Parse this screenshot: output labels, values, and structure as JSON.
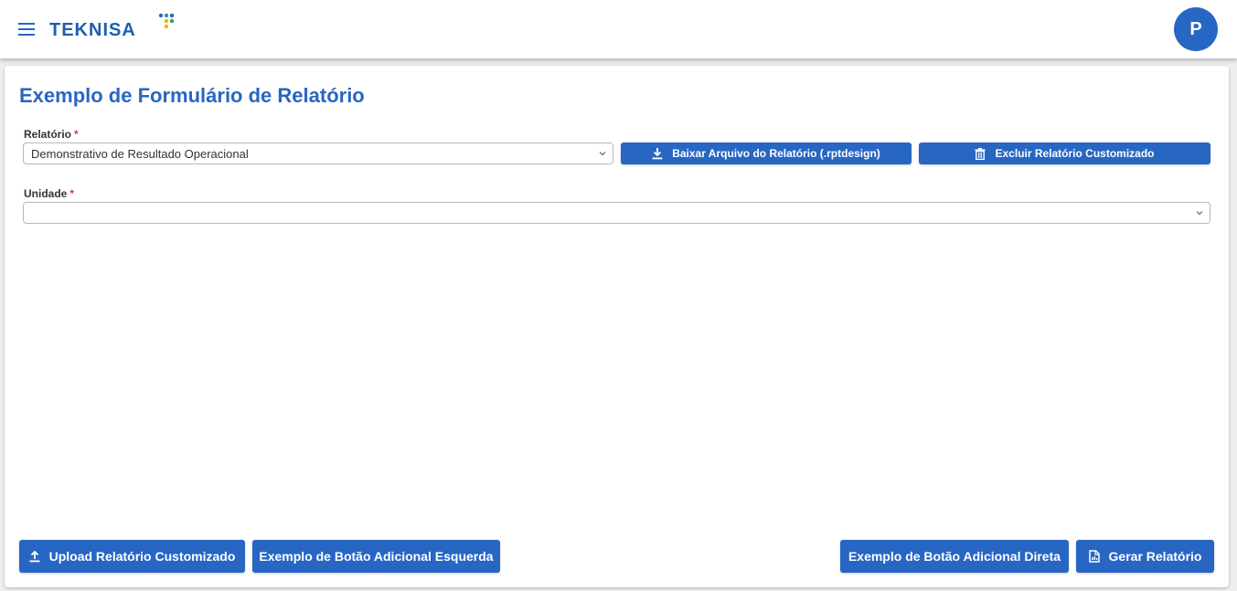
{
  "header": {
    "logo_text": "TEKNISA",
    "avatar_initial": "P",
    "accent_color": "#2866c4"
  },
  "form": {
    "title": "Exemplo de Formulário de Relatório",
    "relatorio": {
      "label": "Relatório",
      "required_mark": "*",
      "value": "Demonstrativo de Resultado Operacional"
    },
    "unidade": {
      "label": "Unidade",
      "required_mark": "*",
      "value": ""
    },
    "buttons": {
      "download": "Baixar Arquivo do Relatório (.rptdesign)",
      "delete": "Excluir Relatório Customizado"
    }
  },
  "footer": {
    "upload": "Upload Relatório Customizado",
    "extra_left": "Exemplo de Botão Adicional Esquerda",
    "extra_right": "Exemplo de Botão Adicional Direta",
    "generate": "Gerar Relatório"
  },
  "icons": [
    "menu-icon",
    "download-icon",
    "trash-icon",
    "upload-icon",
    "file-chart-icon",
    "chevron-down-icon"
  ]
}
